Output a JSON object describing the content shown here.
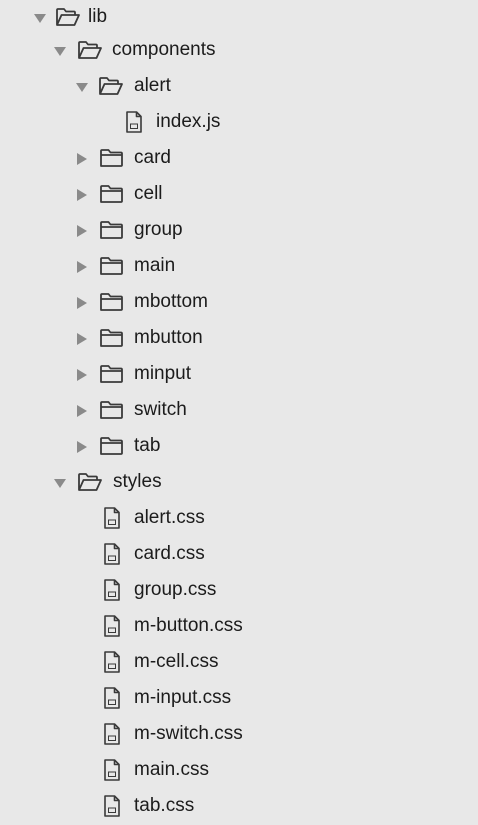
{
  "tree": {
    "lib": {
      "label": "lib",
      "expanded": true,
      "icon": "folder-open-icon"
    },
    "components": {
      "label": "components",
      "expanded": true,
      "icon": "folder-open-icon"
    },
    "alert": {
      "label": "alert",
      "expanded": true,
      "icon": "folder-open-icon"
    },
    "index_js": {
      "label": "index.js",
      "icon": "file-icon"
    },
    "card": {
      "label": "card",
      "expanded": false,
      "icon": "folder-icon"
    },
    "cell": {
      "label": "cell",
      "expanded": false,
      "icon": "folder-icon"
    },
    "group": {
      "label": "group",
      "expanded": false,
      "icon": "folder-icon"
    },
    "main": {
      "label": "main",
      "expanded": false,
      "icon": "folder-icon"
    },
    "mbottom": {
      "label": "mbottom",
      "expanded": false,
      "icon": "folder-icon"
    },
    "mbutton": {
      "label": "mbutton",
      "expanded": false,
      "icon": "folder-icon"
    },
    "minput": {
      "label": "minput",
      "expanded": false,
      "icon": "folder-icon"
    },
    "switch": {
      "label": "switch",
      "expanded": false,
      "icon": "folder-icon"
    },
    "tab": {
      "label": "tab",
      "expanded": false,
      "icon": "folder-icon"
    },
    "styles": {
      "label": "styles",
      "expanded": true,
      "icon": "folder-open-icon"
    },
    "alert_css": {
      "label": "alert.css",
      "icon": "file-icon"
    },
    "card_css": {
      "label": "card.css",
      "icon": "file-icon"
    },
    "group_css": {
      "label": "group.css",
      "icon": "file-icon"
    },
    "m_button_css": {
      "label": "m-button.css",
      "icon": "file-icon"
    },
    "m_cell_css": {
      "label": "m-cell.css",
      "icon": "file-icon"
    },
    "m_input_css": {
      "label": "m-input.css",
      "icon": "file-icon"
    },
    "m_switch_css": {
      "label": "m-switch.css",
      "icon": "file-icon"
    },
    "main_css": {
      "label": "main.css",
      "icon": "file-icon"
    },
    "tab_css": {
      "label": "tab.css",
      "icon": "file-icon"
    }
  },
  "colors": {
    "background": "#e8e8e8",
    "arrow": "#8a8a8a",
    "icon_stroke": "#3a3a3a",
    "text": "#1c1c1c"
  }
}
